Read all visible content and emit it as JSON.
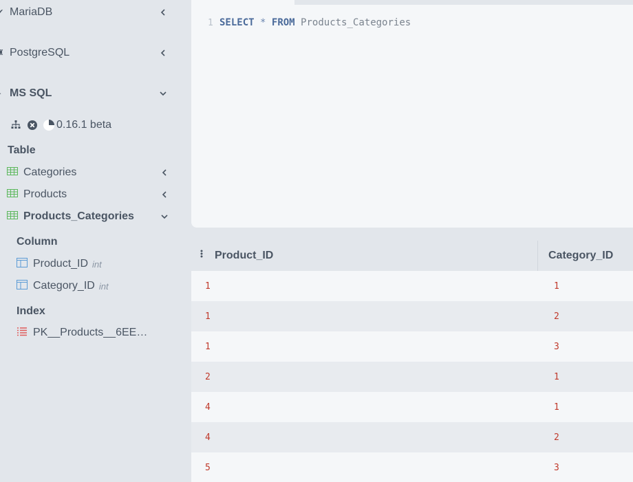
{
  "sidebar": {
    "databases": [
      {
        "label": "MariaDB",
        "icon": "mariadb-icon",
        "expanded": false
      },
      {
        "label": "PostgreSQL",
        "icon": "postgresql-icon",
        "expanded": false
      },
      {
        "label": "MS SQL",
        "icon": "mssql-icon",
        "expanded": true
      }
    ],
    "toolbar": {
      "icons": [
        "schema-diagram-icon",
        "close-circle-icon",
        "pie-chart-icon"
      ],
      "version": "0.16.1 beta"
    },
    "table_section": "Table",
    "tables": [
      {
        "label": "Categories",
        "expanded": false
      },
      {
        "label": "Products",
        "expanded": false
      },
      {
        "label": "Products_Categories",
        "expanded": true
      }
    ],
    "column_section": "Column",
    "columns": [
      {
        "name": "Product_ID",
        "type": "int"
      },
      {
        "name": "Category_ID",
        "type": "int"
      }
    ],
    "index_section": "Index",
    "indexes": [
      {
        "name": "PK__Products__6EE…"
      }
    ]
  },
  "editor": {
    "line_number": "1",
    "kw_select": "SELECT",
    "op_star": "*",
    "kw_from": "FROM",
    "table_name": "Products_Categories"
  },
  "results": {
    "columns": [
      "Product_ID",
      "Category_ID"
    ],
    "rows": [
      [
        "1",
        "1"
      ],
      [
        "1",
        "2"
      ],
      [
        "1",
        "3"
      ],
      [
        "2",
        "1"
      ],
      [
        "4",
        "1"
      ],
      [
        "4",
        "2"
      ],
      [
        "5",
        "3"
      ]
    ]
  },
  "colors": {
    "sidebar_bg": "#e2e6eb",
    "editor_bg": "#f5f7f9",
    "table_icon": "#5cb85c",
    "column_icon": "#5b9bd5",
    "index_icon": "#e05a5a",
    "cell_value": "#c0392b",
    "keyword": "#4a6a9a"
  }
}
